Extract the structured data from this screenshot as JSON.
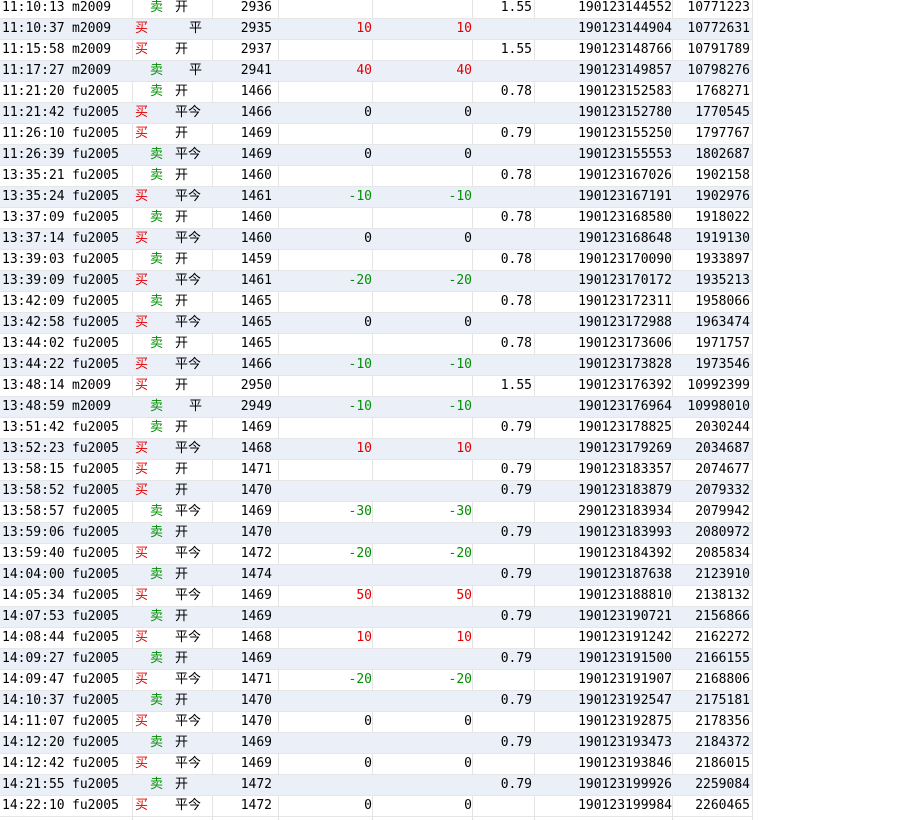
{
  "colors": {
    "buy": "#e00000",
    "sell": "#009000",
    "negative": "#009000",
    "positive": "#e00000",
    "row_alt": "#eaeff8"
  },
  "rows": [
    {
      "time": "11:10:13",
      "code": "m2009",
      "dir": "卖",
      "off": "开",
      "price": "2936",
      "pnl1": "",
      "pnl2": "",
      "fee": "1.55",
      "order": "190123144552",
      "deal": "10771223"
    },
    {
      "time": "11:10:37",
      "code": "m2009",
      "dir": "买",
      "off": "平",
      "price": "2935",
      "pnl1": "10",
      "pnl2": "10",
      "fee": "",
      "order": "190123144904",
      "deal": "10772631"
    },
    {
      "time": "11:15:58",
      "code": "m2009",
      "dir": "买",
      "off": "开",
      "price": "2937",
      "pnl1": "",
      "pnl2": "",
      "fee": "1.55",
      "order": "190123148766",
      "deal": "10791789"
    },
    {
      "time": "11:17:27",
      "code": "m2009",
      "dir": "卖",
      "off": "平",
      "price": "2941",
      "pnl1": "40",
      "pnl2": "40",
      "fee": "",
      "order": "190123149857",
      "deal": "10798276"
    },
    {
      "time": "11:21:20",
      "code": "fu2005",
      "dir": "卖",
      "off": "开",
      "price": "1466",
      "pnl1": "",
      "pnl2": "",
      "fee": "0.78",
      "order": "190123152583",
      "deal": "1768271"
    },
    {
      "time": "11:21:42",
      "code": "fu2005",
      "dir": "买",
      "off": "平今",
      "price": "1466",
      "pnl1": "0",
      "pnl2": "0",
      "fee": "",
      "order": "190123152780",
      "deal": "1770545"
    },
    {
      "time": "11:26:10",
      "code": "fu2005",
      "dir": "买",
      "off": "开",
      "price": "1469",
      "pnl1": "",
      "pnl2": "",
      "fee": "0.79",
      "order": "190123155250",
      "deal": "1797767"
    },
    {
      "time": "11:26:39",
      "code": "fu2005",
      "dir": "卖",
      "off": "平今",
      "price": "1469",
      "pnl1": "0",
      "pnl2": "0",
      "fee": "",
      "order": "190123155553",
      "deal": "1802687"
    },
    {
      "time": "13:35:21",
      "code": "fu2005",
      "dir": "卖",
      "off": "开",
      "price": "1460",
      "pnl1": "",
      "pnl2": "",
      "fee": "0.78",
      "order": "190123167026",
      "deal": "1902158"
    },
    {
      "time": "13:35:24",
      "code": "fu2005",
      "dir": "买",
      "off": "平今",
      "price": "1461",
      "pnl1": "-10",
      "pnl2": "-10",
      "fee": "",
      "order": "190123167191",
      "deal": "1902976"
    },
    {
      "time": "13:37:09",
      "code": "fu2005",
      "dir": "卖",
      "off": "开",
      "price": "1460",
      "pnl1": "",
      "pnl2": "",
      "fee": "0.78",
      "order": "190123168580",
      "deal": "1918022"
    },
    {
      "time": "13:37:14",
      "code": "fu2005",
      "dir": "买",
      "off": "平今",
      "price": "1460",
      "pnl1": "0",
      "pnl2": "0",
      "fee": "",
      "order": "190123168648",
      "deal": "1919130"
    },
    {
      "time": "13:39:03",
      "code": "fu2005",
      "dir": "卖",
      "off": "开",
      "price": "1459",
      "pnl1": "",
      "pnl2": "",
      "fee": "0.78",
      "order": "190123170090",
      "deal": "1933897"
    },
    {
      "time": "13:39:09",
      "code": "fu2005",
      "dir": "买",
      "off": "平今",
      "price": "1461",
      "pnl1": "-20",
      "pnl2": "-20",
      "fee": "",
      "order": "190123170172",
      "deal": "1935213"
    },
    {
      "time": "13:42:09",
      "code": "fu2005",
      "dir": "卖",
      "off": "开",
      "price": "1465",
      "pnl1": "",
      "pnl2": "",
      "fee": "0.78",
      "order": "190123172311",
      "deal": "1958066"
    },
    {
      "time": "13:42:58",
      "code": "fu2005",
      "dir": "买",
      "off": "平今",
      "price": "1465",
      "pnl1": "0",
      "pnl2": "0",
      "fee": "",
      "order": "190123172988",
      "deal": "1963474"
    },
    {
      "time": "13:44:02",
      "code": "fu2005",
      "dir": "卖",
      "off": "开",
      "price": "1465",
      "pnl1": "",
      "pnl2": "",
      "fee": "0.78",
      "order": "190123173606",
      "deal": "1971757"
    },
    {
      "time": "13:44:22",
      "code": "fu2005",
      "dir": "买",
      "off": "平今",
      "price": "1466",
      "pnl1": "-10",
      "pnl2": "-10",
      "fee": "",
      "order": "190123173828",
      "deal": "1973546"
    },
    {
      "time": "13:48:14",
      "code": "m2009",
      "dir": "买",
      "off": "开",
      "price": "2950",
      "pnl1": "",
      "pnl2": "",
      "fee": "1.55",
      "order": "190123176392",
      "deal": "10992399"
    },
    {
      "time": "13:48:59",
      "code": "m2009",
      "dir": "卖",
      "off": "平",
      "price": "2949",
      "pnl1": "-10",
      "pnl2": "-10",
      "fee": "",
      "order": "190123176964",
      "deal": "10998010"
    },
    {
      "time": "13:51:42",
      "code": "fu2005",
      "dir": "卖",
      "off": "开",
      "price": "1469",
      "pnl1": "",
      "pnl2": "",
      "fee": "0.79",
      "order": "190123178825",
      "deal": "2030244"
    },
    {
      "time": "13:52:23",
      "code": "fu2005",
      "dir": "买",
      "off": "平今",
      "price": "1468",
      "pnl1": "10",
      "pnl2": "10",
      "fee": "",
      "order": "190123179269",
      "deal": "2034687"
    },
    {
      "time": "13:58:15",
      "code": "fu2005",
      "dir": "买",
      "off": "开",
      "price": "1471",
      "pnl1": "",
      "pnl2": "",
      "fee": "0.79",
      "order": "190123183357",
      "deal": "2074677"
    },
    {
      "time": "13:58:52",
      "code": "fu2005",
      "dir": "买",
      "off": "开",
      "price": "1470",
      "pnl1": "",
      "pnl2": "",
      "fee": "0.79",
      "order": "190123183879",
      "deal": "2079332"
    },
    {
      "time": "13:58:57",
      "code": "fu2005",
      "dir": "卖",
      "off": "平今",
      "price": "1469",
      "pnl1": "-30",
      "pnl2": "-30",
      "fee": "",
      "order": "290123183934",
      "deal": "2079942"
    },
    {
      "time": "13:59:06",
      "code": "fu2005",
      "dir": "卖",
      "off": "开",
      "price": "1470",
      "pnl1": "",
      "pnl2": "",
      "fee": "0.79",
      "order": "190123183993",
      "deal": "2080972"
    },
    {
      "time": "13:59:40",
      "code": "fu2005",
      "dir": "买",
      "off": "平今",
      "price": "1472",
      "pnl1": "-20",
      "pnl2": "-20",
      "fee": "",
      "order": "190123184392",
      "deal": "2085834"
    },
    {
      "time": "14:04:00",
      "code": "fu2005",
      "dir": "卖",
      "off": "开",
      "price": "1474",
      "pnl1": "",
      "pnl2": "",
      "fee": "0.79",
      "order": "190123187638",
      "deal": "2123910"
    },
    {
      "time": "14:05:34",
      "code": "fu2005",
      "dir": "买",
      "off": "平今",
      "price": "1469",
      "pnl1": "50",
      "pnl2": "50",
      "fee": "",
      "order": "190123188810",
      "deal": "2138132"
    },
    {
      "time": "14:07:53",
      "code": "fu2005",
      "dir": "卖",
      "off": "开",
      "price": "1469",
      "pnl1": "",
      "pnl2": "",
      "fee": "0.79",
      "order": "190123190721",
      "deal": "2156866"
    },
    {
      "time": "14:08:44",
      "code": "fu2005",
      "dir": "买",
      "off": "平今",
      "price": "1468",
      "pnl1": "10",
      "pnl2": "10",
      "fee": "",
      "order": "190123191242",
      "deal": "2162272"
    },
    {
      "time": "14:09:27",
      "code": "fu2005",
      "dir": "卖",
      "off": "开",
      "price": "1469",
      "pnl1": "",
      "pnl2": "",
      "fee": "0.79",
      "order": "190123191500",
      "deal": "2166155"
    },
    {
      "time": "14:09:47",
      "code": "fu2005",
      "dir": "买",
      "off": "平今",
      "price": "1471",
      "pnl1": "-20",
      "pnl2": "-20",
      "fee": "",
      "order": "190123191907",
      "deal": "2168806"
    },
    {
      "time": "14:10:37",
      "code": "fu2005",
      "dir": "卖",
      "off": "开",
      "price": "1470",
      "pnl1": "",
      "pnl2": "",
      "fee": "0.79",
      "order": "190123192547",
      "deal": "2175181"
    },
    {
      "time": "14:11:07",
      "code": "fu2005",
      "dir": "买",
      "off": "平今",
      "price": "1470",
      "pnl1": "0",
      "pnl2": "0",
      "fee": "",
      "order": "190123192875",
      "deal": "2178356"
    },
    {
      "time": "14:12:20",
      "code": "fu2005",
      "dir": "卖",
      "off": "开",
      "price": "1469",
      "pnl1": "",
      "pnl2": "",
      "fee": "0.79",
      "order": "190123193473",
      "deal": "2184372"
    },
    {
      "time": "14:12:42",
      "code": "fu2005",
      "dir": "买",
      "off": "平今",
      "price": "1469",
      "pnl1": "0",
      "pnl2": "0",
      "fee": "",
      "order": "190123193846",
      "deal": "2186015"
    },
    {
      "time": "14:21:55",
      "code": "fu2005",
      "dir": "卖",
      "off": "开",
      "price": "1472",
      "pnl1": "",
      "pnl2": "",
      "fee": "0.79",
      "order": "190123199926",
      "deal": "2259084"
    },
    {
      "time": "14:22:10",
      "code": "fu2005",
      "dir": "买",
      "off": "平今",
      "price": "1472",
      "pnl1": "0",
      "pnl2": "0",
      "fee": "",
      "order": "190123199984",
      "deal": "2260465"
    }
  ]
}
